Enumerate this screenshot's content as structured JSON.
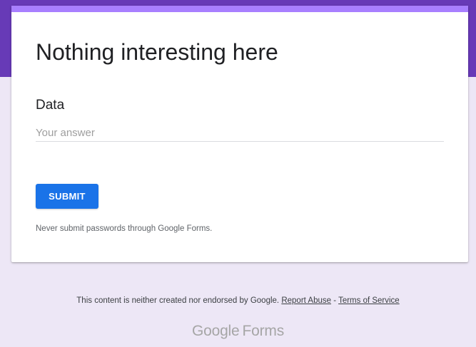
{
  "colors": {
    "header_band": "#673ab7",
    "card_accent": "#a87fff",
    "page_background": "#ede7f6",
    "submit_button": "#1a73e8"
  },
  "form": {
    "title": "Nothing interesting here",
    "question": {
      "label": "Data",
      "placeholder": "Your answer",
      "value": ""
    },
    "submit_label": "SUBMIT",
    "password_note": "Never submit passwords through Google Forms."
  },
  "footer": {
    "disclaimer": "This content is neither created nor endorsed by Google.",
    "report_abuse": "Report Abuse",
    "separator": "-",
    "terms": "Terms of Service"
  },
  "logo": {
    "google": "Google",
    "forms": "Forms"
  }
}
